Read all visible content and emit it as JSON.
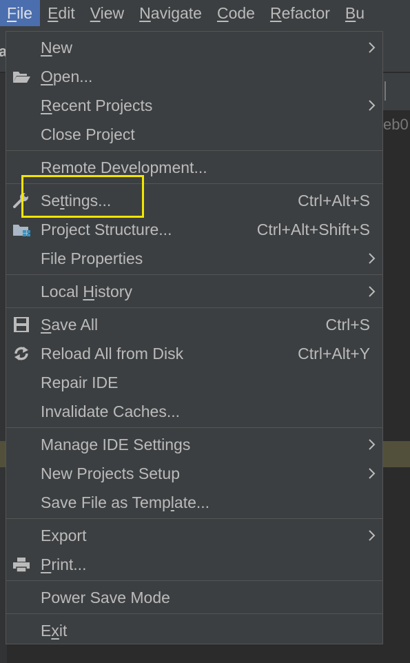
{
  "menubar": {
    "items": [
      {
        "label": "File",
        "mnemonic": "F",
        "rest": "ile"
      },
      {
        "label": "Edit",
        "mnemonic": "E",
        "rest": "dit"
      },
      {
        "label": "View",
        "mnemonic": "V",
        "rest": "iew"
      },
      {
        "label": "Navigate",
        "mnemonic": "N",
        "rest": "avigate"
      },
      {
        "label": "Code",
        "mnemonic": "C",
        "rest": "ode"
      },
      {
        "label": "Refactor",
        "mnemonic": "R",
        "rest": "efactor"
      },
      {
        "label": "Bu",
        "mnemonic": "B",
        "rest": "u"
      }
    ]
  },
  "background": {
    "right_text": "eb0",
    "left_text": "a"
  },
  "file_menu": {
    "new": {
      "pre": "",
      "mn": "N",
      "post": "ew"
    },
    "open": {
      "pre": "",
      "mn": "O",
      "post": "pen..."
    },
    "recent_projects": {
      "pre": "",
      "mn": "R",
      "post": "ecent Projects"
    },
    "close_project": {
      "pre": "Close Project",
      "mn": "",
      "post": ""
    },
    "remote_development": {
      "pre": "Remote Development...",
      "mn": "",
      "post": ""
    },
    "settings": {
      "pre": "Se",
      "mn": "t",
      "post": "tings...",
      "shortcut": "Ctrl+Alt+S"
    },
    "project_structure": {
      "pre": "Project Structure...",
      "mn": "",
      "post": "",
      "shortcut": "Ctrl+Alt+Shift+S"
    },
    "file_properties": {
      "pre": "File Properties",
      "mn": "",
      "post": ""
    },
    "local_history": {
      "pre": "Local ",
      "mn": "H",
      "post": "istory"
    },
    "save_all": {
      "pre": "",
      "mn": "S",
      "post": "ave All",
      "shortcut": "Ctrl+S"
    },
    "reload_all": {
      "pre": "Reload All from Disk",
      "mn": "",
      "post": "",
      "shortcut": "Ctrl+Alt+Y"
    },
    "repair_ide": {
      "pre": "Repair IDE",
      "mn": "",
      "post": ""
    },
    "invalidate_caches": {
      "pre": "Invalidate Caches...",
      "mn": "",
      "post": ""
    },
    "manage_ide_settings": {
      "pre": "Manage IDE Settings",
      "mn": "",
      "post": ""
    },
    "new_projects_setup": {
      "pre": "New Projects Setup",
      "mn": "",
      "post": ""
    },
    "save_file_as_template": {
      "pre": "Save File as Temp",
      "mn": "l",
      "post": "ate..."
    },
    "export": {
      "pre": "Export",
      "mn": "",
      "post": ""
    },
    "print": {
      "pre": "",
      "mn": "P",
      "post": "rint..."
    },
    "power_save_mode": {
      "pre": "Power Save Mode",
      "mn": "",
      "post": ""
    },
    "exit": {
      "pre": "E",
      "mn": "x",
      "post": "it"
    }
  },
  "colors": {
    "menu_bg": "#3c3f41",
    "active_menubar": "#4b6eaf",
    "highlight_box": "#f2e600",
    "text": "#bbbbbb"
  },
  "icons": {
    "open": "folder-open-icon",
    "settings": "wrench-icon",
    "project_structure": "project-structure-icon",
    "save_all": "floppy-disk-icon",
    "reload_all": "reload-icon",
    "print": "printer-icon",
    "submenu": "chevron-right-icon"
  }
}
